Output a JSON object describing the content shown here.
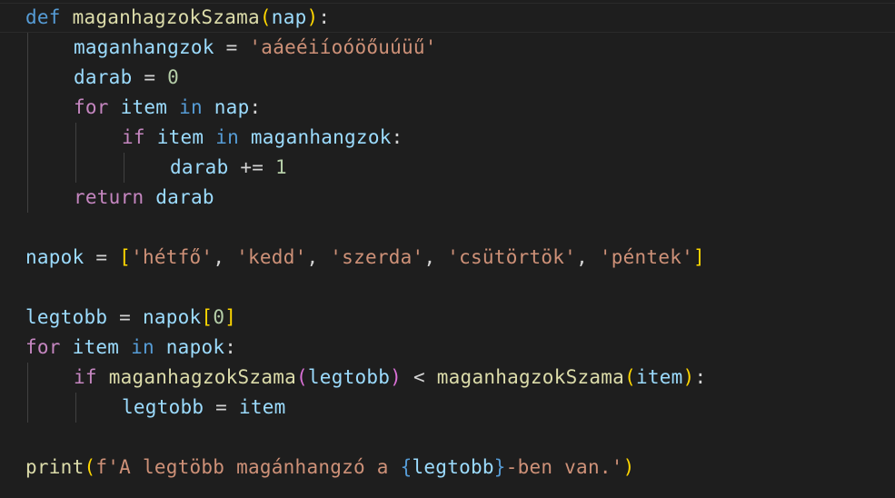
{
  "code": {
    "l1": {
      "kw": "def",
      "fn": "maganhagzokSzama",
      "p_open": "(",
      "param": "nap",
      "p_close": ")",
      "colon": ":"
    },
    "l2": {
      "var": "maganhangzok",
      "eq": " = ",
      "str": "'aáeéiíoóöőuúüű'"
    },
    "l3": {
      "var": "darab",
      "eq": " = ",
      "num": "0"
    },
    "l4": {
      "kw": "for",
      "var": "item",
      "kw2": "in",
      "var2": "nap",
      "colon": ":"
    },
    "l5": {
      "kw": "if",
      "var": "item",
      "kw2": "in",
      "var2": "maganhangzok",
      "colon": ":"
    },
    "l6": {
      "var": "darab",
      "op": " += ",
      "num": "1"
    },
    "l7": {
      "kw": "return",
      "var": "darab"
    },
    "l8": {
      "var": "napok",
      "eq": " = ",
      "b_open": "[",
      "b_close": "]",
      "sep": ", ",
      "items": [
        "'hétfő'",
        "'kedd'",
        "'szerda'",
        "'csütörtök'",
        "'péntek'"
      ]
    },
    "l9": {
      "var": "legtobb",
      "eq": " = ",
      "var2": "napok",
      "b_open": "[",
      "num": "0",
      "b_close": "]"
    },
    "l10": {
      "kw": "for",
      "var": "item",
      "kw2": "in",
      "var2": "napok",
      "colon": ":"
    },
    "l11": {
      "kw": "if",
      "fn": "maganhagzokSzama",
      "p_open": "(",
      "arg1": "legtobb",
      "p_close": ")",
      "lt": " < ",
      "fn2": "maganhagzokSzama",
      "p2_open": "(",
      "arg2": "item",
      "p2_close": ")",
      "colon": ":"
    },
    "l12": {
      "var": "legtobb",
      "eq": " = ",
      "var2": "item"
    },
    "l13": {
      "fn": "print",
      "p_open": "(",
      "str1": "f'A legtöbb magánhangzó a ",
      "c_open": "{",
      "var": "legtobb",
      "c_close": "}",
      "str2": "-ben van.'",
      "p_close": ")"
    }
  }
}
